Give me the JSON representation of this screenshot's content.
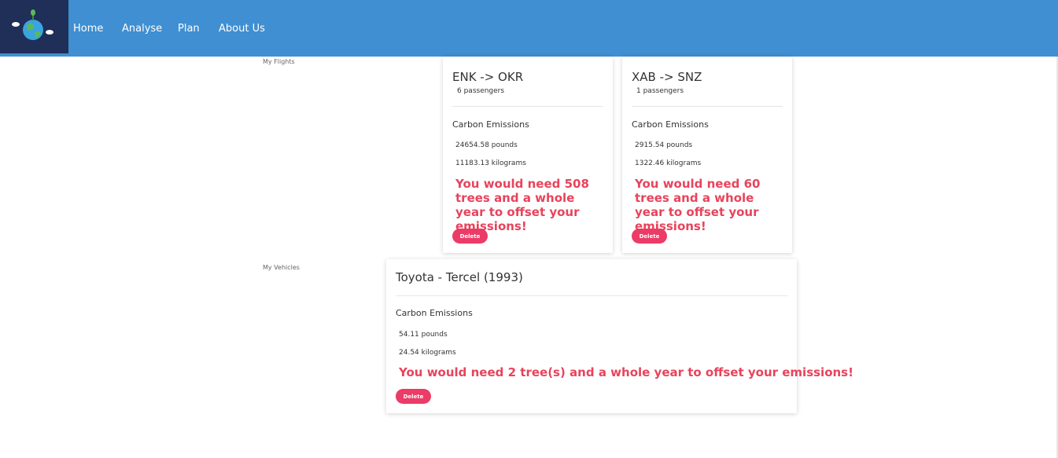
{
  "nav": {
    "logo": "earth-logo-icon",
    "links": [
      "Home",
      "Analyse",
      "Plan",
      "About Us"
    ]
  },
  "flights_section": {
    "label": "My Flights",
    "cards": [
      {
        "route": "ENK -> OKR",
        "passengers": "6 passengers",
        "heading": "Carbon Emissions",
        "pounds": "24654.58 pounds",
        "kilograms": "11183.13 kilograms",
        "message": "You would need 508 trees and a whole year to offset your emissions!",
        "delete_label": "Delete"
      },
      {
        "route": "XAB -> SNZ",
        "passengers": "1 passengers",
        "heading": "Carbon Emissions",
        "pounds": "2915.54 pounds",
        "kilograms": "1322.46 kilograms",
        "message": "You would need 60 trees and a whole year to offset your emissions!",
        "delete_label": "Delete"
      }
    ]
  },
  "vehicles_section": {
    "label": "My Vehicles",
    "cards": [
      {
        "title": "Toyota - Tercel (1993)",
        "heading": "Carbon Emissions",
        "pounds": "54.11 pounds",
        "kilograms": "24.54 kilograms",
        "message": "You would need 2 tree(s) and a whole year to offset your emissions!",
        "delete_label": "Delete"
      }
    ]
  },
  "colors": {
    "navbar": "#3f8fd2",
    "logo_bg": "#1f2f57",
    "message": "#e8435c",
    "delete_button": "#eb3b66"
  }
}
